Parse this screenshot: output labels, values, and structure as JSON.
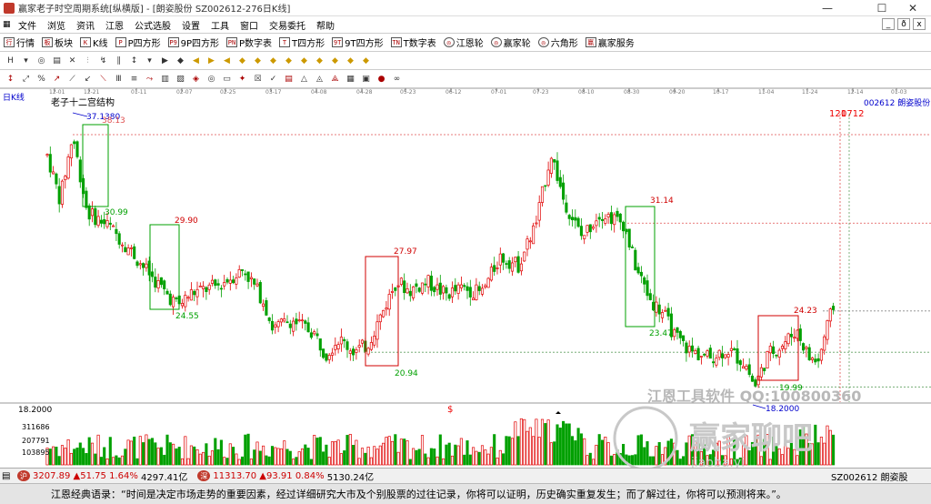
{
  "window": {
    "title": "赢家老子时空周期系统[纵横版] - [朗姿股份  SZ002612-276日K线]",
    "minimize": "—",
    "maximize": "☐",
    "close": "✕"
  },
  "menu": [
    "文件",
    "浏览",
    "资讯",
    "江恩",
    "公式选股",
    "设置",
    "工具",
    "窗口",
    "交易委托",
    "帮助"
  ],
  "mdi_controls": [
    "_",
    "ð",
    "x"
  ],
  "toolbar": [
    {
      "icon": "行",
      "label": "行情"
    },
    {
      "icon": "板",
      "label": "板块"
    },
    {
      "icon": "K",
      "label": "K线"
    },
    {
      "icon": "P",
      "label": "P四方形"
    },
    {
      "icon": "P9",
      "label": "9P四方形"
    },
    {
      "icon": "PN",
      "label": "P数字表"
    },
    {
      "icon": "T",
      "label": "T四方形"
    },
    {
      "icon": "9T",
      "label": "9T四方形"
    },
    {
      "icon": "TN",
      "label": "T数字表"
    },
    {
      "icon": "◎",
      "label": "江恩轮"
    },
    {
      "icon": "◎",
      "label": "赢家轮"
    },
    {
      "icon": "◎",
      "label": "六角形"
    },
    {
      "icon": "赢",
      "label": "赢家服务"
    }
  ],
  "chart": {
    "period_label": "日K线",
    "stock_label": "002612  朗姿股份",
    "indicator_label": "老子十二宫结构",
    "top_right_label": "121",
    "top_right_date": "0712",
    "date_ticks": [
      "12-01",
      "12-21",
      "01-11",
      "02-07",
      "02-25",
      "03-17",
      "04-08",
      "04-28",
      "05-23",
      "06-12",
      "07-01",
      "07-23",
      "08-10",
      "08-30",
      "09-20",
      "10-17",
      "11-04",
      "11-24",
      "12-14",
      "01-03"
    ],
    "price_levels": [
      "37.1380",
      "38.13",
      "30.99",
      "29.90",
      "24.55",
      "27.97",
      "20.94",
      "31.14",
      "23.47",
      "24.23",
      "19.99",
      "18.2000"
    ],
    "low_marker": "18.2000",
    "dollar_mark": "$",
    "volume_labels": [
      "311686",
      "207791",
      "103895"
    ],
    "left_scale": "18.2000",
    "watermark1": "江恩工具软件 QQ:100800360",
    "watermark2": "赢家聊吧",
    "watermark3": "jiaoba.yi"
  },
  "status": {
    "sh_value": "3207.89",
    "sh_change": "▲51.75",
    "sh_pct": "1.64%",
    "sh_amount": "4297.41亿",
    "sz_value": "11313.70",
    "sz_change": "▲93.91",
    "sz_pct": "0.84%",
    "sz_amount": "5130.24亿",
    "stock": "SZ002612 朗姿股"
  },
  "quote": "江恩经典语录：“时间是决定市场走势的重要因素，经过详细研究大市及个别股票的过往记录，你将可以证明，历史确实重复发生；而了解过往，你将可以预测将来。”。",
  "colors": {
    "up": "#e00000",
    "down": "#00a000",
    "box_green": "#00a000",
    "box_red": "#d00000",
    "dash_red": "#e05050",
    "dash_green": "#60a060"
  }
}
